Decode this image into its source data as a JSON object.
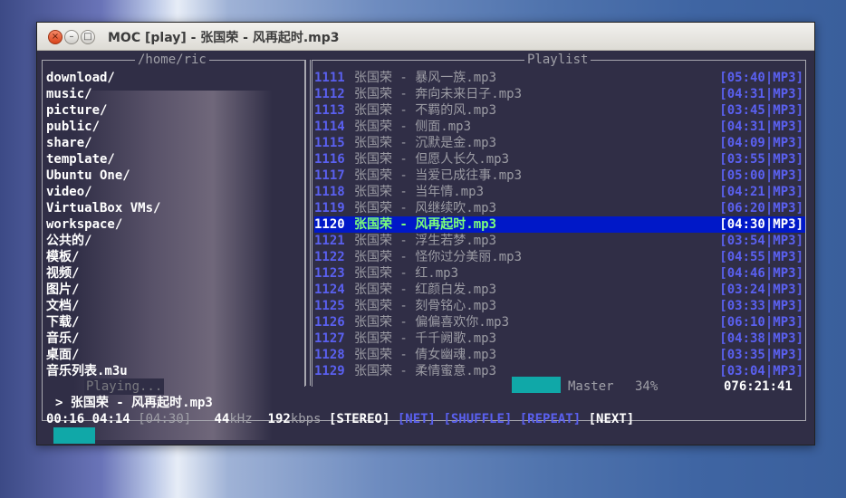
{
  "window": {
    "title": "MOC [play] - 张国荣 - 风再起时.mp3",
    "close_glyph": "×",
    "min_glyph": "–",
    "max_glyph": "□"
  },
  "left_panel": {
    "title": "/home/ric",
    "items": [
      "download/",
      "music/",
      "picture/",
      "public/",
      "share/",
      "template/",
      "Ubuntu One/",
      "video/",
      "VirtualBox VMs/",
      "workspace/",
      "公共的/",
      "模板/",
      "视频/",
      "图片/",
      "文档/",
      "下载/",
      "音乐/",
      "桌面/",
      "音乐列表.m3u"
    ]
  },
  "playlist": {
    "title": "Playlist",
    "selected_index": 9,
    "items": [
      {
        "num": "1111",
        "title": "张国荣 - 暴风一族.mp3",
        "time": "[05:40|MP3]"
      },
      {
        "num": "1112",
        "title": "张国荣 - 奔向未来日子.mp3",
        "time": "[04:31|MP3]"
      },
      {
        "num": "1113",
        "title": "张国荣 - 不羁的风.mp3",
        "time": "[03:45|MP3]"
      },
      {
        "num": "1114",
        "title": "张国荣 - 侧面.mp3",
        "time": "[04:31|MP3]"
      },
      {
        "num": "1115",
        "title": "张国荣 - 沉默是金.mp3",
        "time": "[04:09|MP3]"
      },
      {
        "num": "1116",
        "title": "张国荣 - 但愿人长久.mp3",
        "time": "[03:55|MP3]"
      },
      {
        "num": "1117",
        "title": "张国荣 - 当爱已成往事.mp3",
        "time": "[05:00|MP3]"
      },
      {
        "num": "1118",
        "title": "张国荣 - 当年情.mp3",
        "time": "[04:21|MP3]"
      },
      {
        "num": "1119",
        "title": "张国荣 - 风继续吹.mp3",
        "time": "[06:20|MP3]"
      },
      {
        "num": "1120",
        "title": "张国荣 - 风再起时.mp3",
        "time": "[04:30|MP3]"
      },
      {
        "num": "1121",
        "title": "张国荣 - 浮生若梦.mp3",
        "time": "[03:54|MP3]"
      },
      {
        "num": "1122",
        "title": "张国荣 - 怪你过分美丽.mp3",
        "time": "[04:55|MP3]"
      },
      {
        "num": "1123",
        "title": "张国荣 - 红.mp3",
        "time": "[04:46|MP3]"
      },
      {
        "num": "1124",
        "title": "张国荣 - 红颜白发.mp3",
        "time": "[03:24|MP3]"
      },
      {
        "num": "1125",
        "title": "张国荣 - 刻骨铭心.mp3",
        "time": "[03:33|MP3]"
      },
      {
        "num": "1126",
        "title": "张国荣 - 偏偏喜欢你.mp3",
        "time": "[06:10|MP3]"
      },
      {
        "num": "1127",
        "title": "张国荣 - 千千阙歌.mp3",
        "time": "[04:38|MP3]"
      },
      {
        "num": "1128",
        "title": "张国荣 - 倩女幽魂.mp3",
        "time": "[03:35|MP3]"
      },
      {
        "num": "1129",
        "title": "张国荣 - 柔情蜜意.mp3",
        "time": "[03:04|MP3]"
      }
    ]
  },
  "status": {
    "state": "Playing...",
    "mixer_label": "Master",
    "volume": "34%",
    "volume_fraction": 0.34,
    "total_time": "076:21:41",
    "now_playing": "> 张国荣 - 风再起时.mp3",
    "elapsed": "00:16",
    "remaining": "04:14",
    "total": "[04:30]",
    "rate_value": "44",
    "rate_unit": "kHz",
    "bitrate_value": "192",
    "bitrate_unit": "kbps",
    "flags": [
      "[STEREO]",
      "[NET]",
      "[SHUFFLE]",
      "[REPEAT]",
      "[NEXT]"
    ],
    "progress_fraction": 0.06
  },
  "colors": {
    "terminal_bg": "#302e46",
    "selected_bg": "#0018c8",
    "selected_fg": "#7bff7b",
    "accent_blue": "#5a60f0",
    "bar_cyan": "#10a8a8"
  }
}
